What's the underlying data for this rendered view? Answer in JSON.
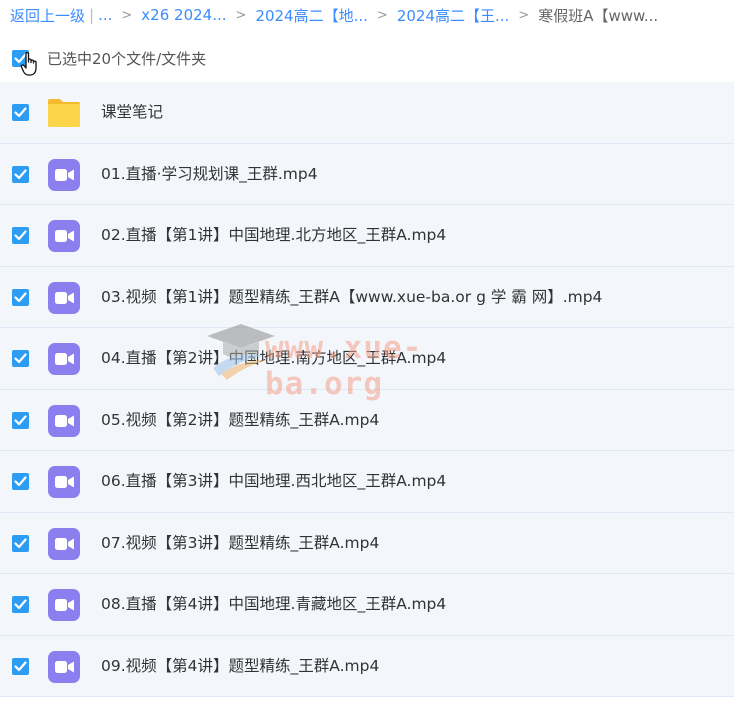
{
  "breadcrumb": {
    "back": "返回上一级",
    "sep_bar": "|",
    "ellipsis": "...",
    "crumbs": [
      "x26 2024...",
      "2024高二【地...",
      "2024高二【王..."
    ],
    "current": "寒假班A【www...",
    "chevron": ">"
  },
  "selection": {
    "text": "已选中20个文件/文件夹"
  },
  "files": [
    {
      "name": "课堂笔记",
      "type": "folder"
    },
    {
      "name": "01.直播·学习规划课_王群.mp4",
      "type": "video"
    },
    {
      "name": "02.直播【第1讲】中国地理.北方地区_王群A.mp4",
      "type": "video"
    },
    {
      "name": "03.视频【第1讲】题型精练_王群A【www.xue-ba.or g 学 霸 网】.mp4",
      "type": "video"
    },
    {
      "name": "04.直播【第2讲】中国地理.南方地区_王群A.mp4",
      "type": "video"
    },
    {
      "name": "05.视频【第2讲】题型精练_王群A.mp4",
      "type": "video"
    },
    {
      "name": "06.直播【第3讲】中国地理.西北地区_王群A.mp4",
      "type": "video"
    },
    {
      "name": "07.视频【第3讲】题型精练_王群A.mp4",
      "type": "video"
    },
    {
      "name": "08.直播【第4讲】中国地理.青藏地区_王群A.mp4",
      "type": "video"
    },
    {
      "name": "09.视频【第4讲】题型精练_王群A.mp4",
      "type": "video"
    }
  ],
  "watermark": {
    "text": "www.xue-ba.org"
  },
  "colors": {
    "accent": "#3b8cff",
    "checkbox": "#2d9cf3",
    "video_icon": "#8b7ff0",
    "folder_icon": "#fbc93d",
    "row_bg": "#f3f7fc"
  }
}
